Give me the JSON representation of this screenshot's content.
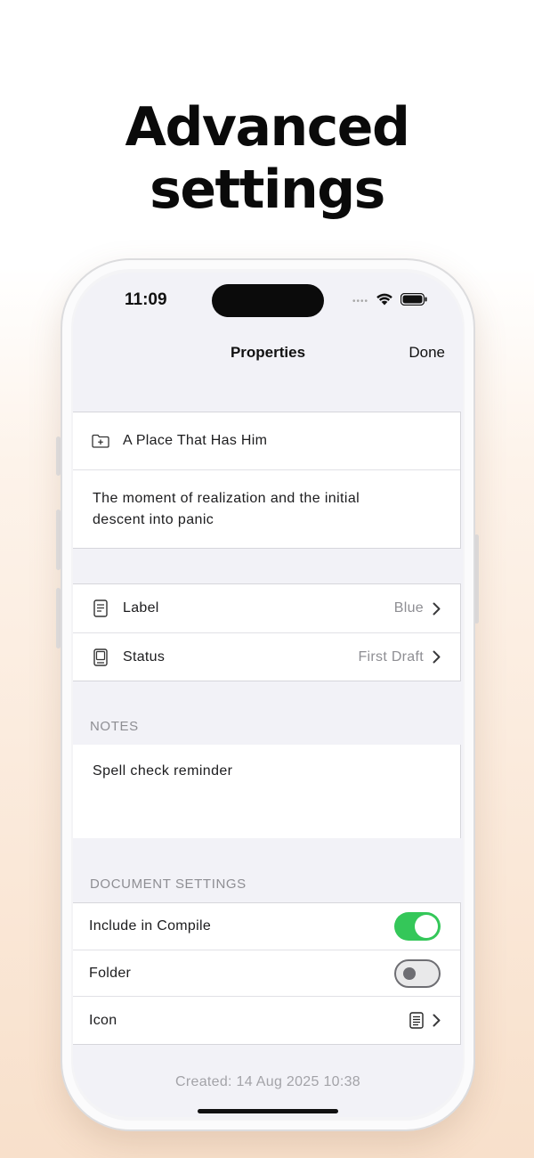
{
  "headline": "Advanced settings",
  "status_bar": {
    "time": "11:09",
    "icons": [
      "cellular-dots-icon",
      "wifi-icon",
      "battery-icon"
    ]
  },
  "nav": {
    "title": "Properties",
    "done_label": "Done"
  },
  "document": {
    "title": "A Place That Has Him",
    "synopsis": "The moment of realization and the initial descent into panic"
  },
  "meta": {
    "label": {
      "label": "Label",
      "value": "Blue"
    },
    "status": {
      "label": "Status",
      "value": "First Draft"
    }
  },
  "notes": {
    "header": "NOTES",
    "text": "Spell check reminder"
  },
  "document_settings": {
    "header": "DOCUMENT SETTINGS",
    "include_in_compile": {
      "label": "Include in Compile",
      "on": true
    },
    "folder": {
      "label": "Folder",
      "on": false
    },
    "icon": {
      "label": "Icon",
      "icon": "document-icon"
    }
  },
  "footer": {
    "created": "Created: 14 Aug 2025 10:38"
  },
  "colors": {
    "toggle_on": "#34c759",
    "grouped_background": "#f2f2f7",
    "secondary_text": "#8e8e93"
  }
}
